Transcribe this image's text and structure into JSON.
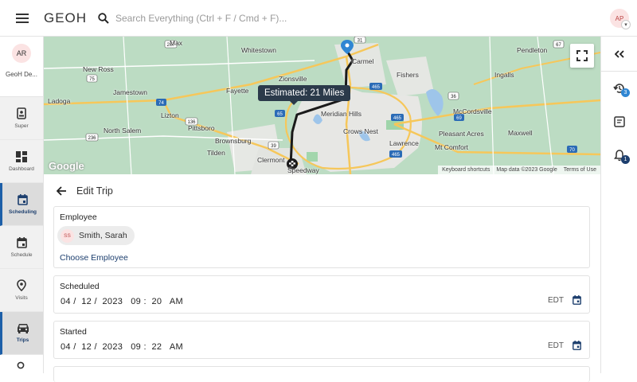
{
  "header": {
    "logo": "GEOH",
    "search_placeholder": "Search Everything (Ctrl + F / Cmd + F)...",
    "avatar_initials": "AP"
  },
  "sidebar": {
    "user_initials": "AR",
    "org_name": "GeoH De...",
    "items": [
      {
        "label": "Super",
        "icon": "id-badge-icon"
      },
      {
        "label": "Dashboard",
        "icon": "dashboard-grid-icon"
      },
      {
        "label": "Scheduling",
        "icon": "calendar-icon",
        "active": true
      },
      {
        "label": "Schedule",
        "icon": "calendar-icon"
      },
      {
        "label": "Visits",
        "icon": "location-pin-icon"
      },
      {
        "label": "Trips",
        "icon": "car-icon",
        "active": true
      }
    ]
  },
  "rail": {
    "collapse_icon": "double-chevron-left-icon",
    "history_badge": "3",
    "notes_icon": "notes-icon",
    "bell_badge": "1"
  },
  "map": {
    "estimate_label": "Estimated: 21 Miles",
    "google_logo": "Google",
    "footer": {
      "shortcuts": "Keyboard shortcuts",
      "map_data": "Map data ©2023 Google",
      "terms": "Terms of Use"
    },
    "towns": [
      "Max",
      "Whitestown",
      "Carmel",
      "Pendleton",
      "New Ross",
      "Jamestown",
      "Zionsville",
      "Fishers",
      "Ingalls",
      "Fayette",
      "Ladoga",
      "Lizton",
      "Meridian Hills",
      "McCordsville",
      "North Salem",
      "Pittsboro",
      "Crows Nest",
      "Pleasant Acres",
      "Maxwell",
      "Brownsburg",
      "Lawrence",
      "Mt Comfort",
      "Tilden",
      "Clermont",
      "Speedway"
    ],
    "road_shields": [
      "31",
      "74",
      "65",
      "465",
      "69",
      "36",
      "236",
      "75",
      "39",
      "136",
      "465",
      "465",
      "70",
      "67",
      "267"
    ]
  },
  "edit_trip": {
    "title": "Edit Trip",
    "employee": {
      "label": "Employee",
      "chip_initials": "SS",
      "chip_name": "Smith, Sarah",
      "choose_link": "Choose Employee"
    },
    "scheduled": {
      "label": "Scheduled",
      "value": "04 /  12 /  2023   09 :  20   AM",
      "tz": "EDT"
    },
    "started": {
      "label": "Started",
      "value": "04 /  12 /  2023   09 :  22   AM",
      "tz": "EDT"
    }
  },
  "colors": {
    "accent": "#1d3f6e",
    "map_land": "#bcdcc3",
    "route": "#1a1a1a"
  }
}
